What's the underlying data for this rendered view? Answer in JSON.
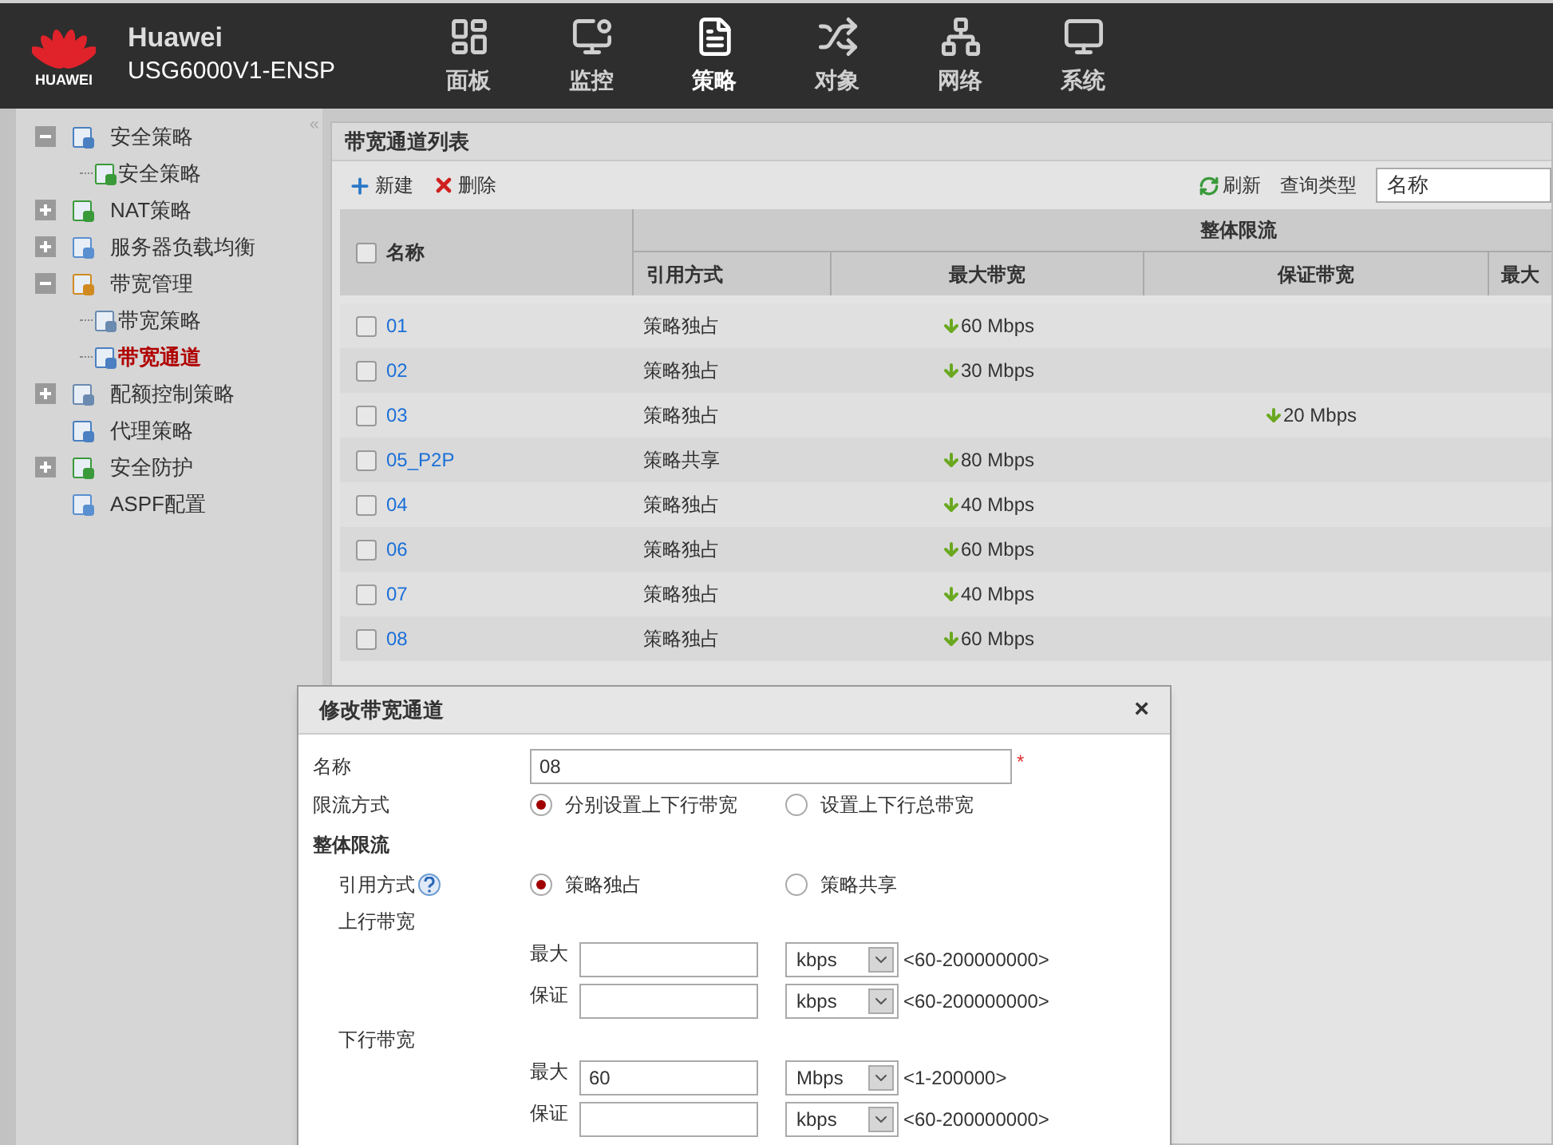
{
  "header": {
    "logo_text": "HUAWEI",
    "brand": "Huawei",
    "model": "USG6000V1-ENSP",
    "nav": [
      {
        "label": "面板",
        "kind": "dashboard",
        "selected": false
      },
      {
        "label": "监控",
        "kind": "monitor",
        "selected": false
      },
      {
        "label": "策略",
        "kind": "policy",
        "selected": true
      },
      {
        "label": "对象",
        "kind": "object",
        "selected": false
      },
      {
        "label": "网络",
        "kind": "network",
        "selected": false
      },
      {
        "label": "系统",
        "kind": "system",
        "selected": false
      }
    ]
  },
  "sidebar": {
    "collapse": "«",
    "items": [
      {
        "label": "安全策略",
        "kind": "group",
        "expanded": true,
        "selected": false,
        "children": [
          {
            "label": "安全策略",
            "selected": false
          }
        ]
      },
      {
        "label": "NAT策略",
        "kind": "group",
        "expanded": false,
        "selected": false
      },
      {
        "label": "服务器负载均衡",
        "kind": "group",
        "expanded": false,
        "selected": false
      },
      {
        "label": "带宽管理",
        "kind": "group",
        "expanded": true,
        "selected": false,
        "children": [
          {
            "label": "带宽策略",
            "selected": false
          },
          {
            "label": "带宽通道",
            "selected": true
          }
        ]
      },
      {
        "label": "配额控制策略",
        "kind": "group",
        "expanded": false,
        "selected": false
      },
      {
        "label": "代理策略",
        "kind": "leaf",
        "selected": false
      },
      {
        "label": "安全防护",
        "kind": "group",
        "expanded": false,
        "selected": false
      },
      {
        "label": "ASPF配置",
        "kind": "leaf",
        "selected": false
      }
    ]
  },
  "panel": {
    "title": "带宽通道列表",
    "toolbar": {
      "new": "新建",
      "delete": "删除",
      "refresh": "刷新",
      "query_label": "查询类型",
      "query_value": "名称"
    },
    "table": {
      "all_checked": false,
      "name_column": "名称",
      "group_heading": "整体限流",
      "columns": [
        "引用方式",
        "最大带宽",
        "保证带宽",
        "最大"
      ],
      "rows": [
        {
          "name": "01",
          "mode": "策略独占",
          "max": "60 Mbps",
          "checked": false
        },
        {
          "name": "02",
          "mode": "策略独占",
          "max": "30 Mbps",
          "checked": false
        },
        {
          "name": "03",
          "mode": "策略独占",
          "guarantee": "20 Mbps",
          "checked": false
        },
        {
          "name": "05_P2P",
          "mode": "策略共享",
          "max": "80 Mbps",
          "checked": false
        },
        {
          "name": "04",
          "mode": "策略独占",
          "max": "40 Mbps",
          "checked": false
        },
        {
          "name": "06",
          "mode": "策略独占",
          "max": "60 Mbps",
          "checked": false
        },
        {
          "name": "07",
          "mode": "策略独占",
          "max": "40 Mbps",
          "checked": false
        },
        {
          "name": "08",
          "mode": "策略独占",
          "max": "60 Mbps",
          "checked": false
        }
      ]
    }
  },
  "dialog": {
    "title": "修改带宽通道",
    "close": "×",
    "name_label": "名称",
    "name_value": "08",
    "required": "*",
    "limit_label": "限流方式",
    "limit_options": [
      {
        "label": "分别设置上下行带宽",
        "selected": true
      },
      {
        "label": "设置上下行总带宽",
        "selected": false
      }
    ],
    "section": "整体限流",
    "ref_label": "引用方式",
    "ref_options": [
      {
        "label": "策略独占",
        "selected": true
      },
      {
        "label": "策略共享",
        "selected": false
      }
    ],
    "groups": [
      {
        "label": "上行带宽",
        "fields": [
          {
            "label": "最大",
            "unit": "kbps",
            "range": "<60-200000000>"
          },
          {
            "label": "保证",
            "unit": "kbps",
            "range": "<60-200000000>"
          }
        ]
      },
      {
        "label": "下行带宽",
        "fields": [
          {
            "label": "最大",
            "value": "60",
            "unit": "Mbps",
            "range": "<1-200000>"
          },
          {
            "label": "保证",
            "unit": "kbps",
            "range": "<60-200000000>"
          }
        ]
      }
    ]
  }
}
